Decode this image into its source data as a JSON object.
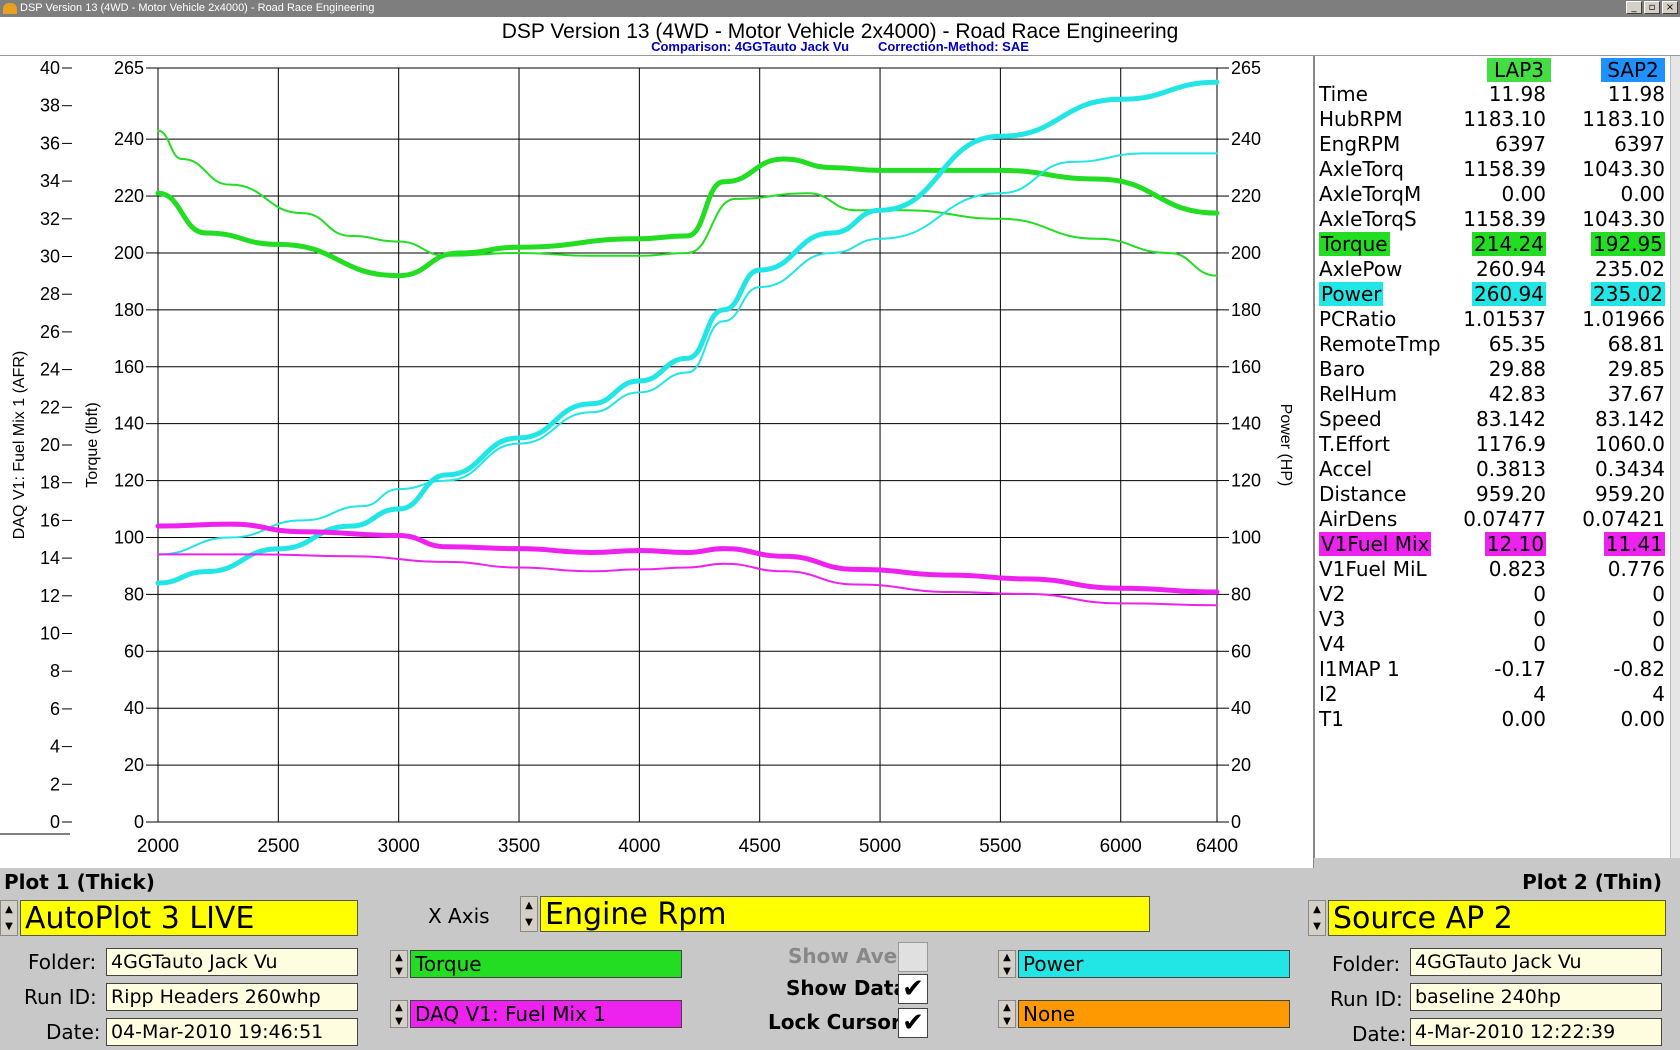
{
  "window": {
    "title": "DSP Version 13 (4WD - Motor Vehicle 2x4000) - Road Race Engineering",
    "buttons": [
      "_",
      "▫",
      "×"
    ]
  },
  "header": {
    "title": "DSP Version 13 (4WD - Motor Vehicle 2x4000) - Road Race Engineering",
    "comparison": "Comparison: 4GGTauto Jack Vu",
    "correction": "Correction-Method: SAE"
  },
  "chart_data": {
    "type": "line",
    "xlabel": "",
    "x_ticks": [
      "2000",
      "2500",
      "3000",
      "3500",
      "4000",
      "4500",
      "5000",
      "5500",
      "6000",
      "6400"
    ],
    "xlim": [
      2000,
      6400
    ],
    "y_left_outer": {
      "label": "DAQ V1: Fuel Mix 1 (AFR)",
      "lim": [
        0,
        40
      ],
      "ticks": [
        "0",
        "2",
        "4",
        "6",
        "8",
        "10",
        "12",
        "14",
        "16",
        "18",
        "20",
        "22",
        "24",
        "26",
        "28",
        "30",
        "32",
        "34",
        "36",
        "38",
        "40"
      ]
    },
    "y_left_inner": {
      "label": "Torque (lbft)",
      "lim": [
        0,
        265
      ],
      "ticks": [
        "0",
        "20",
        "40",
        "60",
        "80",
        "100",
        "120",
        "140",
        "160",
        "180",
        "200",
        "220",
        "240",
        "265"
      ]
    },
    "y_right": {
      "label": "Power (HP)",
      "lim": [
        0,
        265
      ],
      "ticks": [
        "0",
        "20",
        "40",
        "60",
        "80",
        "100",
        "120",
        "140",
        "160",
        "180",
        "200",
        "220",
        "240",
        "265"
      ]
    },
    "grid": true,
    "series": [
      {
        "name": "Torque",
        "axis": "torque",
        "color": "#22dd22",
        "width": 5,
        "points": [
          [
            2000,
            221
          ],
          [
            2200,
            207
          ],
          [
            2500,
            203
          ],
          [
            3000,
            192
          ],
          [
            3250,
            200
          ],
          [
            3500,
            202
          ],
          [
            4000,
            205
          ],
          [
            4200,
            206
          ],
          [
            4350,
            225
          ],
          [
            4600,
            233
          ],
          [
            4800,
            230
          ],
          [
            5000,
            229
          ],
          [
            5500,
            229
          ],
          [
            5900,
            226
          ],
          [
            6400,
            214
          ]
        ]
      },
      {
        "name": "Torque",
        "axis": "torque",
        "color": "#22dd22",
        "width": 2,
        "points": [
          [
            2000,
            243
          ],
          [
            2100,
            233
          ],
          [
            2300,
            224
          ],
          [
            2600,
            214
          ],
          [
            2800,
            206
          ],
          [
            3000,
            204
          ],
          [
            3200,
            199
          ],
          [
            3500,
            200
          ],
          [
            3800,
            199
          ],
          [
            4000,
            199
          ],
          [
            4200,
            200
          ],
          [
            4400,
            219
          ],
          [
            4700,
            221
          ],
          [
            4900,
            215
          ],
          [
            5100,
            215
          ],
          [
            5500,
            212
          ],
          [
            5900,
            205
          ],
          [
            6200,
            200
          ],
          [
            6400,
            192
          ]
        ]
      },
      {
        "name": "Power",
        "axis": "power",
        "color": "#22e5e5",
        "width": 5,
        "points": [
          [
            2000,
            84
          ],
          [
            2200,
            88
          ],
          [
            2500,
            96
          ],
          [
            2800,
            104
          ],
          [
            3000,
            110
          ],
          [
            3200,
            122
          ],
          [
            3500,
            135
          ],
          [
            3800,
            147
          ],
          [
            4000,
            155
          ],
          [
            4200,
            163
          ],
          [
            4350,
            180
          ],
          [
            4500,
            194
          ],
          [
            4800,
            207
          ],
          [
            5000,
            215
          ],
          [
            5500,
            241
          ],
          [
            6000,
            254
          ],
          [
            6400,
            260
          ]
        ]
      },
      {
        "name": "Power",
        "axis": "power",
        "color": "#22e5e5",
        "width": 2,
        "points": [
          [
            2000,
            94
          ],
          [
            2300,
            100
          ],
          [
            2600,
            106
          ],
          [
            2850,
            111
          ],
          [
            3000,
            117
          ],
          [
            3200,
            120
          ],
          [
            3500,
            133
          ],
          [
            3800,
            144
          ],
          [
            4000,
            151
          ],
          [
            4200,
            158
          ],
          [
            4350,
            176
          ],
          [
            4500,
            188
          ],
          [
            4800,
            200
          ],
          [
            5000,
            205
          ],
          [
            5500,
            221
          ],
          [
            5800,
            232
          ],
          [
            6100,
            235
          ],
          [
            6400,
            235
          ]
        ]
      },
      {
        "name": "DAQ V1: Fuel Mix 1",
        "axis": "afr",
        "color": "#ee22ee",
        "width": 5,
        "points": [
          [
            2000,
            15.7
          ],
          [
            2300,
            15.8
          ],
          [
            2600,
            15.4
          ],
          [
            3000,
            15.2
          ],
          [
            3200,
            14.6
          ],
          [
            3500,
            14.5
          ],
          [
            3800,
            14.3
          ],
          [
            4000,
            14.4
          ],
          [
            4200,
            14.3
          ],
          [
            4350,
            14.5
          ],
          [
            4600,
            14.1
          ],
          [
            4900,
            13.4
          ],
          [
            5300,
            13.1
          ],
          [
            5600,
            12.9
          ],
          [
            6000,
            12.4
          ],
          [
            6400,
            12.2
          ]
        ]
      },
      {
        "name": "DAQ V1: Fuel Mix 1",
        "axis": "afr",
        "color": "#ee22ee",
        "width": 2,
        "points": [
          [
            2000,
            14.2
          ],
          [
            2400,
            14.2
          ],
          [
            2800,
            14.1
          ],
          [
            3200,
            13.8
          ],
          [
            3500,
            13.5
          ],
          [
            3800,
            13.3
          ],
          [
            4000,
            13.4
          ],
          [
            4200,
            13.5
          ],
          [
            4350,
            13.7
          ],
          [
            4600,
            13.3
          ],
          [
            4900,
            12.6
          ],
          [
            5300,
            12.2
          ],
          [
            5600,
            12.1
          ],
          [
            6000,
            11.6
          ],
          [
            6400,
            11.5
          ]
        ]
      }
    ]
  },
  "panel": {
    "col1": "LAP3",
    "col1_color": "#44dd44",
    "col2": "SAP2",
    "col2_color": "#1e90ff",
    "rows": [
      {
        "name": "Time",
        "v1": "11.98",
        "v2": "11.98"
      },
      {
        "name": "HubRPM",
        "v1": "1183.10",
        "v2": "1183.10"
      },
      {
        "name": "EngRPM",
        "v1": "6397",
        "v2": "6397"
      },
      {
        "name": "AxleTorq",
        "v1": "1158.39",
        "v2": "1043.30"
      },
      {
        "name": "AxleTorqM",
        "v1": "0.00",
        "v2": "0.00"
      },
      {
        "name": "AxleTorqS",
        "v1": "1158.39",
        "v2": "1043.30"
      },
      {
        "name": "Torque",
        "v1": "214.24",
        "v2": "192.95",
        "hl": "#22dd22"
      },
      {
        "name": "AxlePow",
        "v1": "260.94",
        "v2": "235.02"
      },
      {
        "name": "Power",
        "v1": "260.94",
        "v2": "235.02",
        "hl": "#22e5e5"
      },
      {
        "name": "PCRatio",
        "v1": "1.01537",
        "v2": "1.01966"
      },
      {
        "name": "RemoteTmp",
        "v1": "65.35",
        "v2": "68.81"
      },
      {
        "name": "Baro",
        "v1": "29.88",
        "v2": "29.85"
      },
      {
        "name": "RelHum",
        "v1": "42.83",
        "v2": "37.67"
      },
      {
        "name": "Speed",
        "v1": "83.142",
        "v2": "83.142"
      },
      {
        "name": "T.Effort",
        "v1": "1176.9",
        "v2": "1060.0"
      },
      {
        "name": "Accel",
        "v1": "0.3813",
        "v2": "0.3434"
      },
      {
        "name": "Distance",
        "v1": "959.20",
        "v2": "959.20"
      },
      {
        "name": "AirDens",
        "v1": "0.07477",
        "v2": "0.07421"
      },
      {
        "name": "V1Fuel Mix",
        "v1": "12.10",
        "v2": "11.41",
        "hl": "#ee22ee"
      },
      {
        "name": "V1Fuel MiL",
        "v1": "0.823",
        "v2": "0.776"
      },
      {
        "name": "V2",
        "v1": "0",
        "v2": "0"
      },
      {
        "name": "V3",
        "v1": "0",
        "v2": "0"
      },
      {
        "name": "V4",
        "v1": "0",
        "v2": "0"
      },
      {
        "name": "I1MAP 1",
        "v1": "-0.17",
        "v2": "-0.82"
      },
      {
        "name": "I2",
        "v1": "4",
        "v2": "4"
      },
      {
        "name": "T1",
        "v1": "0.00",
        "v2": "0.00"
      }
    ]
  },
  "bottom": {
    "plot1_label": "Plot 1 (Thick)",
    "plot2_label": "Plot 2 (Thin)",
    "plot1_source": "AutoPlot 3 LIVE",
    "plot2_source": "Source AP 2",
    "xaxis_label": "X Axis",
    "xaxis_value": "Engine Rpm",
    "folder_label": "Folder:",
    "runid_label": "Run ID:",
    "date_label": "Date:",
    "plot1": {
      "folder": "4GGTauto Jack Vu",
      "run_id": "Ripp Headers 260whp",
      "date": "04-Mar-2010 19:46:51"
    },
    "plot2": {
      "folder": "4GGTauto Jack Vu",
      "run_id": "baseline 240hp",
      "date": "4-Mar-2010 12:22:39"
    },
    "channel1": "Torque",
    "channel2": "DAQ V1: Fuel Mix 1",
    "channel3": "Power",
    "channel4": "None",
    "channel_colors": {
      "torque": "#22dd22",
      "fuel": "#ee22ee",
      "power": "#22e5e5",
      "none": "#ff9900"
    },
    "show_ave_label": "Show Ave.",
    "show_data_label": "Show Data",
    "lock_cursor_label": "Lock Cursor",
    "show_ave": false,
    "show_data": true,
    "lock_cursor": true
  }
}
